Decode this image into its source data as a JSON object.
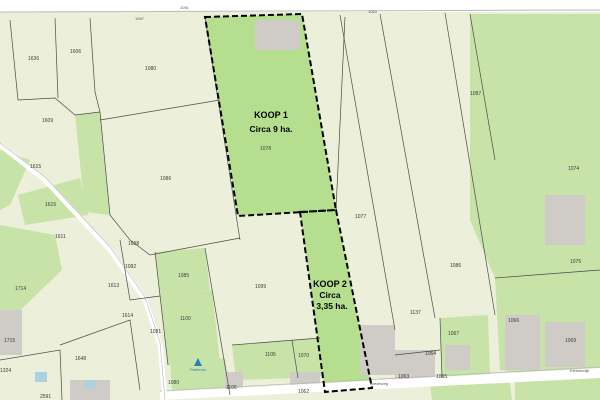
{
  "map": {
    "colors": {
      "base": "#ecefd9",
      "grass": "#c7e3a8",
      "koop": "#b5df8e",
      "building": "#cfcbc6",
      "road": "#ffffff",
      "road_edge": "#b9b9b9",
      "boundary": "#4a4a4a",
      "water": "#aad3df"
    },
    "roads": {
      "top_label": "1091",
      "top_left_label": "1067",
      "top_right_label": "1063",
      "bottom_label_1": "Bredeweg",
      "bottom_label_2": "Kleinendijk"
    },
    "koop1": {
      "title": "KOOP 1",
      "subtitle": "Circa 9 ha.",
      "parcel": "1078"
    },
    "koop2": {
      "title": "KOOP 2",
      "line2": "Circa",
      "line3": "3,35 ha."
    },
    "poi": {
      "label": "Parkeren",
      "icon": "parking-icon"
    },
    "parcels": {
      "p1636": "1636",
      "p1606": "1606",
      "p1080": "1080",
      "p1609": "1609",
      "p1086": "1086",
      "p1615": "1615",
      "p1611": "1611",
      "p1614": "1614",
      "p1613": "1613",
      "p1608": "1608",
      "p1082": "1082",
      "p1714": "1714",
      "p1085": "1085",
      "p1100": "1100",
      "p1614b": "1614",
      "p1081": "1081",
      "p1648": "1648",
      "p1715": "1715",
      "p1324": "1324",
      "p2591": "2591",
      "p1099": "1099",
      "p1105": "1105",
      "p1070": "1070",
      "p1077": "1077",
      "p1137": "1137",
      "p1086b": "1086",
      "p1087": "1087",
      "p1074": "1074",
      "p1075": "1075",
      "p1067": "1067",
      "p1066": "1066",
      "p1069": "1069",
      "p1064": "1064",
      "p1063": "1063",
      "p1065": "1065",
      "p1062": "1062",
      "p1106": "1106",
      "p1080b": "1080"
    }
  }
}
